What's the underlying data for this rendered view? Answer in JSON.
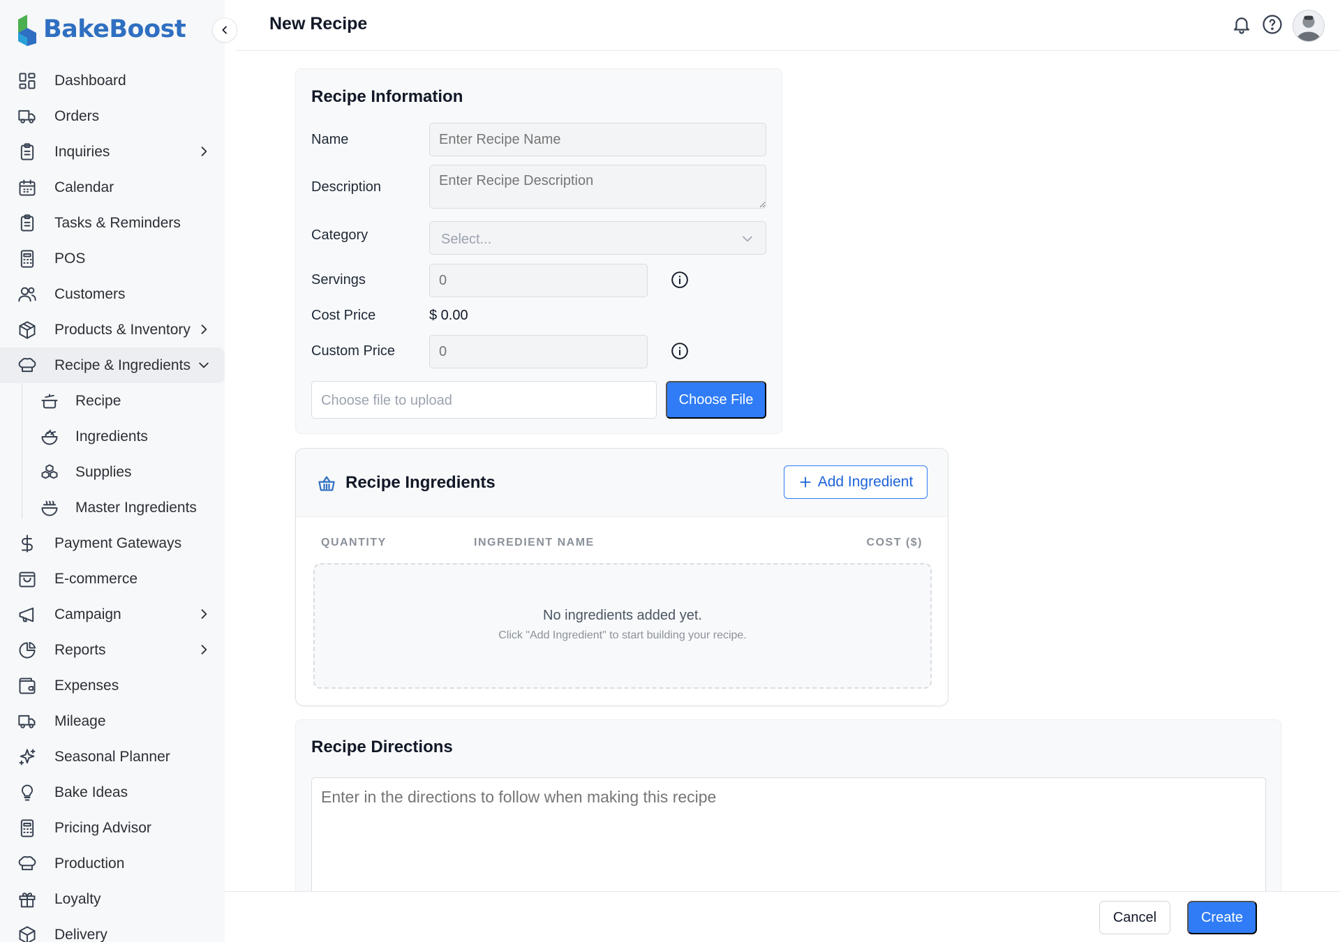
{
  "app": {
    "name": "BakeBoost",
    "brand_color": "#2f6fc1",
    "accent_color": "#2f7cf6"
  },
  "header": {
    "title": "New Recipe",
    "icons": [
      "bell-icon",
      "help-icon",
      "avatar"
    ]
  },
  "sidebar": {
    "items": [
      {
        "label": "Dashboard",
        "icon": "dashboard-icon"
      },
      {
        "label": "Orders",
        "icon": "truck-icon"
      },
      {
        "label": "Inquiries",
        "icon": "clipboard-icon",
        "has_children": true
      },
      {
        "label": "Calendar",
        "icon": "calendar-icon"
      },
      {
        "label": "Tasks & Reminders",
        "icon": "clipboard-icon"
      },
      {
        "label": "POS",
        "icon": "calculator-icon"
      },
      {
        "label": "Customers",
        "icon": "users-icon"
      },
      {
        "label": "Products & Inventory",
        "icon": "box-icon",
        "has_children": true
      },
      {
        "label": "Recipe & Ingredients",
        "icon": "chef-hat-icon",
        "expanded": true
      },
      {
        "label": "Payment Gateways",
        "icon": "dollar-icon"
      },
      {
        "label": "E-commerce",
        "icon": "shopping-bag-icon"
      },
      {
        "label": "Campaign",
        "icon": "megaphone-icon",
        "has_children": true
      },
      {
        "label": "Reports",
        "icon": "pie-chart-icon",
        "has_children": true
      },
      {
        "label": "Expenses",
        "icon": "wallet-icon"
      },
      {
        "label": "Mileage",
        "icon": "truck-icon"
      },
      {
        "label": "Seasonal Planner",
        "icon": "sparkles-icon"
      },
      {
        "label": "Bake Ideas",
        "icon": "lightbulb-icon"
      },
      {
        "label": "Pricing Advisor",
        "icon": "calculator-icon"
      },
      {
        "label": "Production",
        "icon": "chef-hat-icon"
      },
      {
        "label": "Loyalty",
        "icon": "gift-icon"
      },
      {
        "label": "Delivery",
        "icon": "package-icon"
      }
    ],
    "subitems": [
      {
        "label": "Recipe",
        "icon": "cooking-pot-icon"
      },
      {
        "label": "Ingredients",
        "icon": "salad-icon"
      },
      {
        "label": "Supplies",
        "icon": "boxes-icon"
      },
      {
        "label": "Master Ingredients",
        "icon": "bowl-icon"
      }
    ]
  },
  "recipe_info": {
    "title": "Recipe Information",
    "name_label": "Name",
    "name_placeholder": "Enter Recipe Name",
    "description_label": "Description",
    "description_placeholder": "Enter Recipe Description",
    "category_label": "Category",
    "category_value": "Select...",
    "servings_label": "Servings",
    "servings_placeholder": "0",
    "cost_price_label": "Cost Price",
    "cost_price_value": "$ 0.00",
    "custom_price_label": "Custom Price",
    "custom_price_placeholder": "0",
    "file_placeholder": "Choose file to upload",
    "choose_file_label": "Choose File"
  },
  "ingredients": {
    "title": "Recipe Ingredients",
    "add_label": "Add Ingredient",
    "columns": [
      "QUANTITY",
      "INGREDIENT NAME",
      "COST ($)"
    ],
    "empty_title": "No ingredients added yet.",
    "empty_hint": "Click \"Add Ingredient\" to start building your recipe."
  },
  "directions": {
    "title": "Recipe Directions",
    "placeholder": "Enter in the directions to follow when making this recipe"
  },
  "footer": {
    "cancel_label": "Cancel",
    "create_label": "Create"
  }
}
